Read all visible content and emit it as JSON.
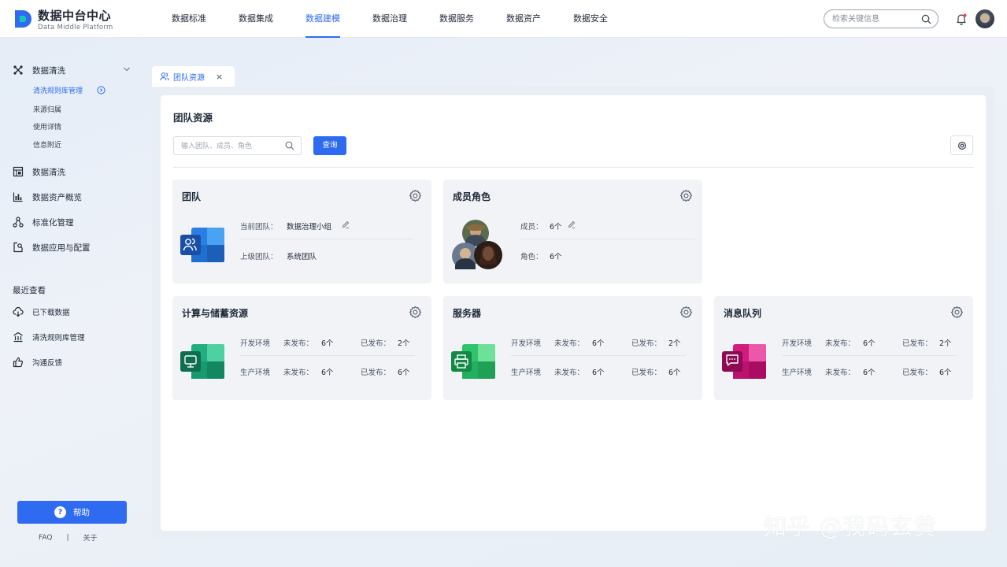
{
  "app": {
    "title": "数据中台中心",
    "subtitle": "Data Middle Platform"
  },
  "nav": {
    "items": [
      "数据标准",
      "数据集成",
      "数据建模",
      "数据治理",
      "数据服务",
      "数据资产",
      "数据安全"
    ],
    "active_index": 2
  },
  "header": {
    "search_placeholder": "检索关键信息"
  },
  "sidebar": {
    "groups": [
      {
        "label": "数据清洗",
        "icon": "data-clean-icon",
        "expanded": true
      },
      {
        "label": "数据清洗",
        "icon": "table-icon"
      },
      {
        "label": "数据资产概览",
        "icon": "bar-chart-icon"
      },
      {
        "label": "标准化管理",
        "icon": "hierarchy-icon"
      },
      {
        "label": "数据应用与配置",
        "icon": "app-config-icon"
      }
    ],
    "sub_items": [
      "清洗规则库管理",
      "来源归属",
      "使用详情",
      "信息附近"
    ],
    "active_sub_index": 0,
    "recent_title": "最近查看",
    "recent_items": [
      {
        "label": "已下载数据",
        "icon": "cloud-download-icon"
      },
      {
        "label": "清洗规则库管理",
        "icon": "building-icon"
      },
      {
        "label": "沟通反馈",
        "icon": "thumbs-up-icon"
      }
    ],
    "help_label": "帮助",
    "footer": {
      "faq": "FAQ",
      "sep": "|",
      "about": "关于"
    }
  },
  "tab": {
    "label": "团队资源",
    "close": "×"
  },
  "main": {
    "title": "团队资源",
    "filter_placeholder": "输入团队、成员、角色",
    "query_label": "查询"
  },
  "cards": {
    "team": {
      "title": "团队",
      "rows": [
        {
          "key": "当前团队：",
          "value": "数据治理小组"
        },
        {
          "key": "上级团队：",
          "value": "系统团队"
        }
      ]
    },
    "members": {
      "title": "成员角色",
      "rows": [
        {
          "key": "成员：",
          "value": "6个"
        },
        {
          "key": "角色：",
          "value": "6个"
        }
      ]
    },
    "compute": {
      "title": "计算与储蓄资源",
      "rows": [
        {
          "env": "开发环境",
          "unpub_label": "未发布：",
          "unpub": "6个",
          "pub_label": "已发布：",
          "pub": "2个"
        },
        {
          "env": "生产环境",
          "unpub_label": "未发布：",
          "unpub": "6个",
          "pub_label": "已发布：",
          "pub": "6个"
        }
      ]
    },
    "server": {
      "title": "服务器",
      "rows": [
        {
          "env": "开发环境",
          "unpub_label": "未发布：",
          "unpub": "6个",
          "pub_label": "已发布：",
          "pub": "2个"
        },
        {
          "env": "生产环境",
          "unpub_label": "未发布：",
          "unpub": "6个",
          "pub_label": "已发布：",
          "pub": "6个"
        }
      ]
    },
    "queue": {
      "title": "消息队列",
      "rows": [
        {
          "env": "开发环境",
          "unpub_label": "未发布：",
          "unpub": "6个",
          "pub_label": "已发布：",
          "pub": "2个"
        },
        {
          "env": "生产环境",
          "unpub_label": "未发布：",
          "unpub": "6个",
          "pub_label": "已发布：",
          "pub": "6个"
        }
      ]
    }
  },
  "watermark": "知乎 @我码玄黄",
  "colors": {
    "accent": "#2f6bf1",
    "team_icon": "#1f5fc9",
    "compute_icon": "#16a37a",
    "server_icon": "#22b36a",
    "queue_icon": "#c0136f"
  }
}
